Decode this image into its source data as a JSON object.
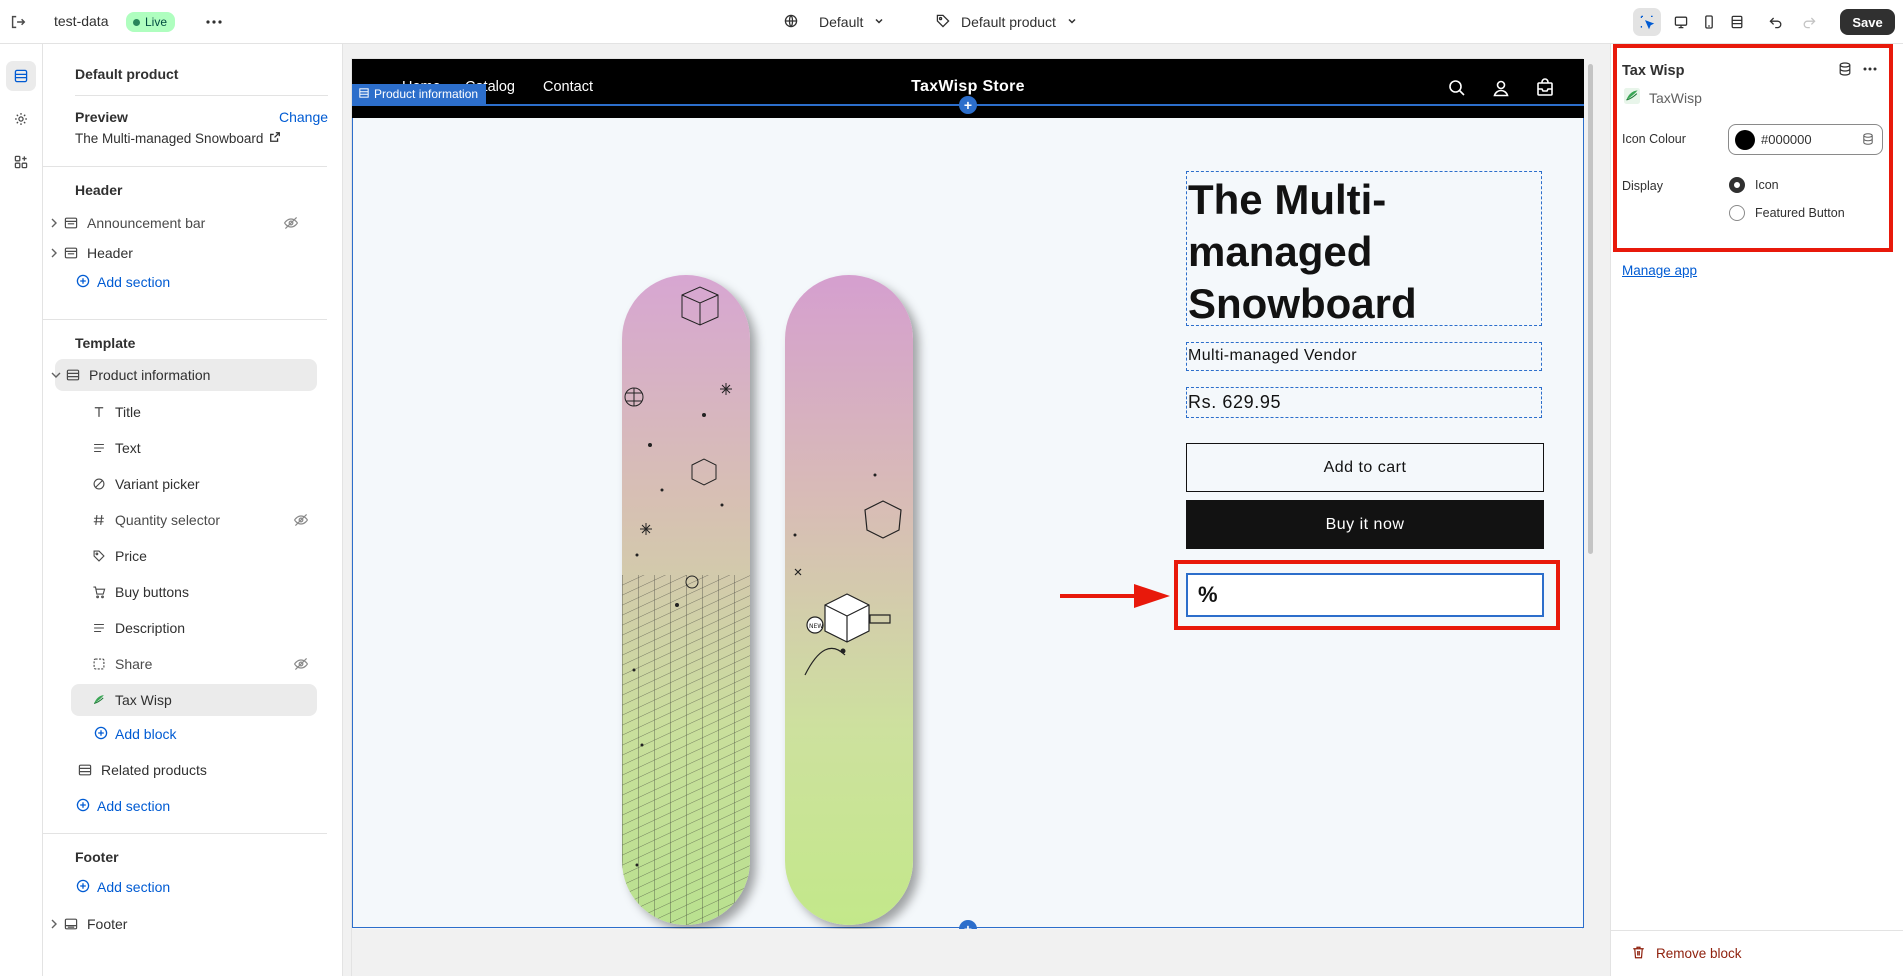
{
  "topbar": {
    "theme_name": "test-data",
    "status_badge": "Live",
    "more": "•••",
    "template_select": "Default",
    "product_select": "Default product",
    "save_label": "Save"
  },
  "sidebar": {
    "title": "Default product",
    "preview": {
      "label": "Preview",
      "change": "Change",
      "product": "The Multi-managed Snowboard"
    },
    "header_group": {
      "label": "Header",
      "items": [
        {
          "label": "Announcement bar",
          "hidden": true
        },
        {
          "label": "Header",
          "hidden": false
        }
      ],
      "add": "Add section"
    },
    "template_group": {
      "label": "Template",
      "section": "Product information",
      "blocks": [
        {
          "label": "Title",
          "icon": "title-icon",
          "hidden": false
        },
        {
          "label": "Text",
          "icon": "text-icon",
          "hidden": false
        },
        {
          "label": "Variant picker",
          "icon": "variant-icon",
          "hidden": false
        },
        {
          "label": "Quantity selector",
          "icon": "hash-icon",
          "hidden": true
        },
        {
          "label": "Price",
          "icon": "price-tag-icon",
          "hidden": false
        },
        {
          "label": "Buy buttons",
          "icon": "cart-icon",
          "hidden": false
        },
        {
          "label": "Description",
          "icon": "text-icon",
          "hidden": false
        },
        {
          "label": "Share",
          "icon": "share-icon",
          "hidden": true
        },
        {
          "label": "Tax Wisp",
          "icon": "taxwisp-icon",
          "hidden": false,
          "selected": true
        }
      ],
      "add_block": "Add block",
      "related": "Related products",
      "add": "Add section"
    },
    "footer_group": {
      "label": "Footer",
      "add": "Add section",
      "item": "Footer"
    }
  },
  "preview": {
    "nav": [
      "Home",
      "Catalog",
      "Contact"
    ],
    "store_name": "TaxWisp Store",
    "section_badge": "Product information",
    "product_title": "The Multi-managed Snowboard",
    "vendor": "Multi-managed Vendor",
    "price": "Rs. 629.95",
    "add_to_cart": "Add to cart",
    "buy_now": "Buy it now",
    "tax_widget_text": "%"
  },
  "panel": {
    "title": "Tax Wisp",
    "app_name": "TaxWisp",
    "icon_colour_label": "Icon Colour",
    "icon_colour_value": "#000000",
    "display_label": "Display",
    "display_options": [
      {
        "label": "Icon",
        "selected": true
      },
      {
        "label": "Featured Button",
        "selected": false
      }
    ],
    "manage_app": "Manage app",
    "remove_block": "Remove block"
  },
  "colors": {
    "accent_blue": "#005bd3",
    "highlight_red": "#e8190b",
    "live_green": "#affebf",
    "store_header": "#000000"
  }
}
